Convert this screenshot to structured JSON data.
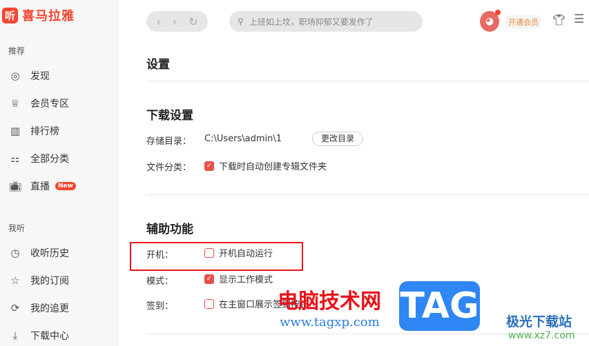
{
  "app": {
    "logo_icon": "听",
    "name": "喜马拉雅"
  },
  "sidebar": {
    "section1": "推荐",
    "items1": [
      {
        "label": "发现",
        "icon": "compass-icon"
      },
      {
        "label": "会员专区",
        "icon": "crown-icon"
      },
      {
        "label": "排行榜",
        "icon": "ranking-icon"
      },
      {
        "label": "全部分类",
        "icon": "grid-icon"
      },
      {
        "label": "直播",
        "icon": "tv-icon",
        "badge": "New"
      }
    ],
    "section2": "我听",
    "items2": [
      {
        "label": "收听历史",
        "icon": "clock-icon"
      },
      {
        "label": "我的订阅",
        "icon": "star-icon"
      },
      {
        "label": "我的追更",
        "icon": "refresh-icon"
      },
      {
        "label": "下载中心",
        "icon": "download-icon"
      }
    ]
  },
  "topbar": {
    "search_placeholder": "上班如上坟，职场抑郁又要发作了",
    "vip": "开通会员"
  },
  "settings": {
    "title": "设置",
    "download": {
      "title": "下载设置",
      "dir_label": "存储目录：",
      "dir_value": "C:\\Users\\admin\\1",
      "change_btn": "更改目录",
      "class_label": "文件分类：",
      "class_option": "下载时自动创建专辑文件夹",
      "class_checked": true
    },
    "aux": {
      "title": "辅助功能",
      "boot_label": "开机：",
      "boot_option": "开机自动运行",
      "boot_checked": false,
      "mode_label": "模式：",
      "mode_option": "显示工作模式",
      "mode_checked": true,
      "sign_label": "签到：",
      "sign_option": "在主窗口展示签到按钮",
      "sign_checked": false
    }
  },
  "watermark": {
    "cn": "电脑技术网",
    "url": "www.tagxp.com",
    "tag": "TAG",
    "site": "极光下载站",
    "site_url": "www.xz7.com"
  },
  "colors": {
    "accent": "#f5452f",
    "check": "#e8504a"
  }
}
